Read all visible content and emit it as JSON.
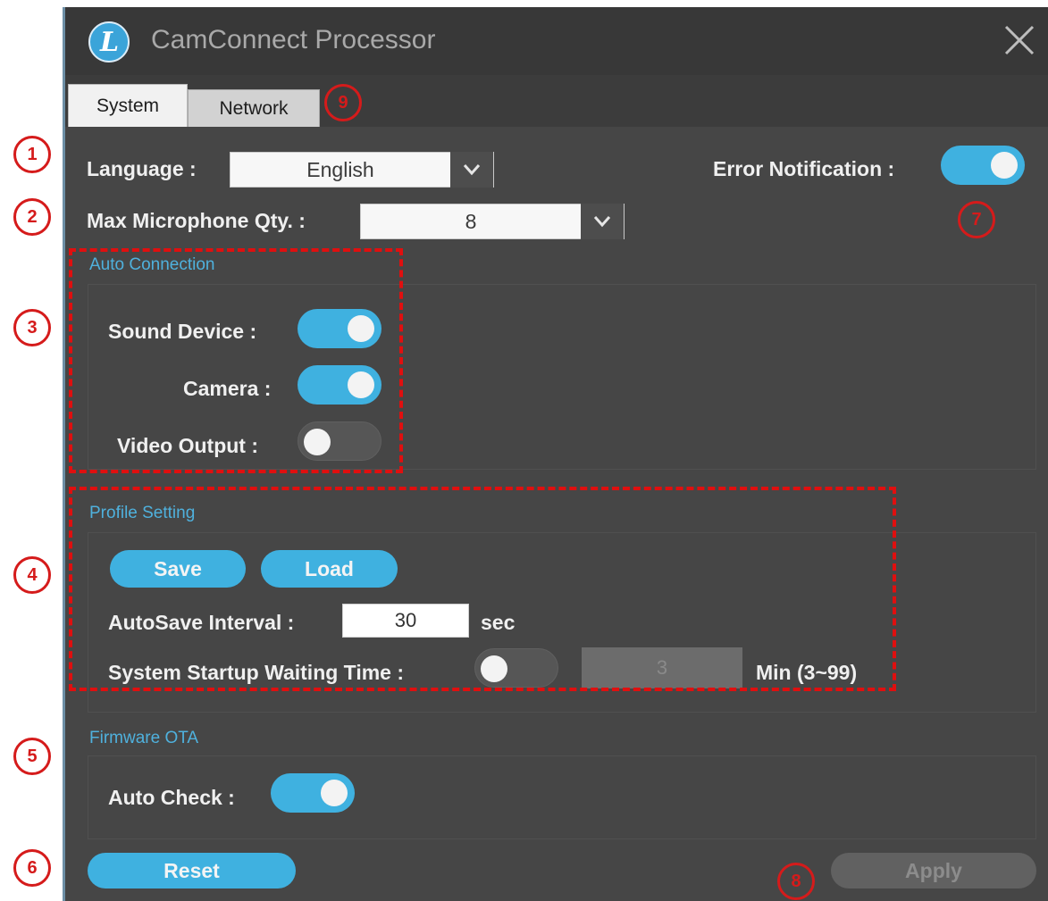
{
  "window": {
    "title": "CamConnect Processor",
    "logo_letter": "L",
    "close_icon": "close-x-icon"
  },
  "tabs": [
    {
      "label": "System",
      "active": true
    },
    {
      "label": "Network",
      "active": false
    }
  ],
  "system": {
    "language_label": "Language :",
    "language_value": "English",
    "error_notification_label": "Error Notification :",
    "error_notification_on": true,
    "max_mic_label": "Max Microphone Qty. :",
    "max_mic_value": "8"
  },
  "auto_connection": {
    "title": "Auto Connection",
    "sound_device_label": "Sound Device :",
    "sound_device_on": true,
    "camera_label": "Camera :",
    "camera_on": true,
    "video_output_label": "Video Output :",
    "video_output_on": false
  },
  "profile_setting": {
    "title": "Profile Setting",
    "save_label": "Save",
    "load_label": "Load",
    "autosave_label": "AutoSave Interval :",
    "autosave_value": "30",
    "autosave_unit": "sec",
    "startup_label": "System Startup Waiting Time :",
    "startup_on": false,
    "startup_value": "3",
    "startup_unit": "Min (3~99)"
  },
  "firmware_ota": {
    "title": "Firmware OTA",
    "auto_check_label": "Auto Check :",
    "auto_check_on": true
  },
  "footer": {
    "reset_label": "Reset",
    "apply_label": "Apply"
  },
  "annotations": [
    "1",
    "2",
    "3",
    "4",
    "5",
    "6",
    "7",
    "8",
    "9"
  ],
  "colors": {
    "accent": "#3fb1e0",
    "window_bg": "#464646",
    "annotation_red": "#d51b1b"
  }
}
